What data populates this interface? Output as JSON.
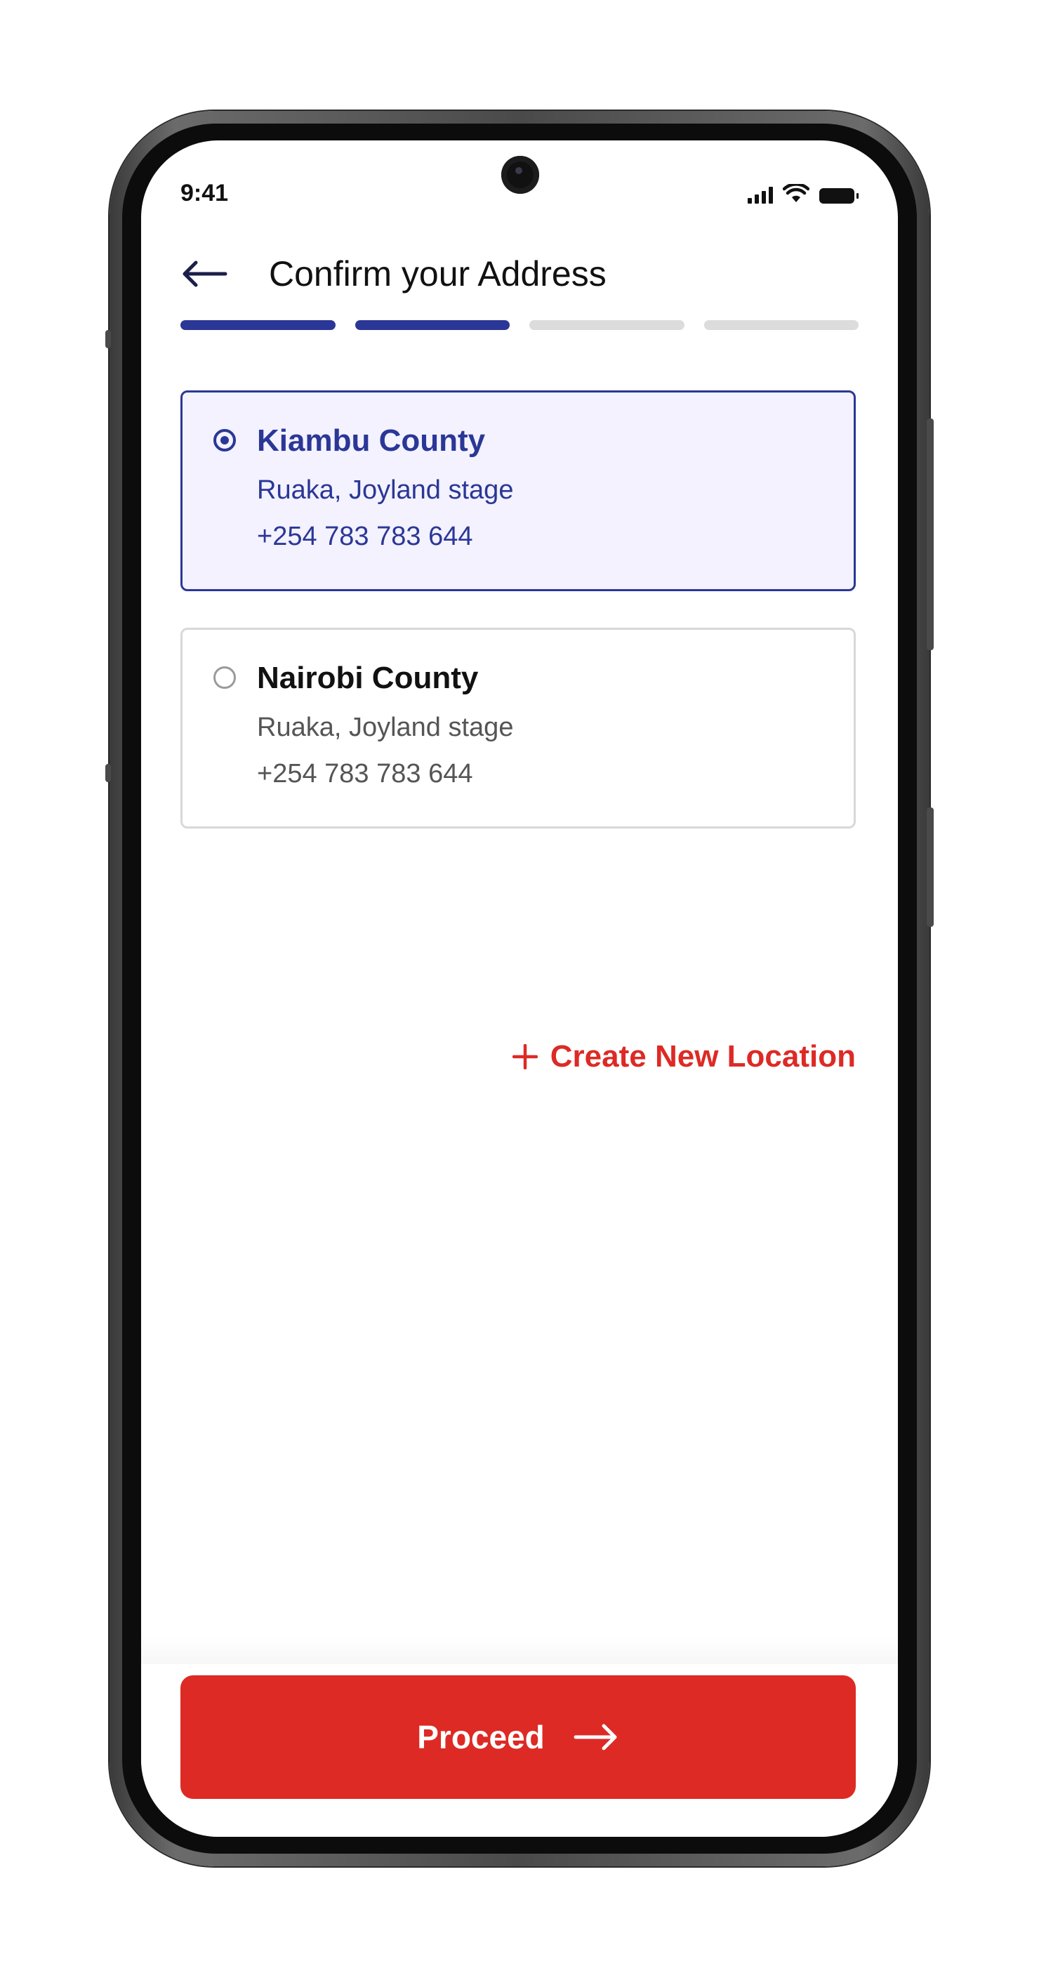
{
  "status_bar": {
    "time": "9:41",
    "icons": [
      "signal-icon",
      "wifi-icon",
      "battery-icon"
    ]
  },
  "header": {
    "back_icon": "arrow-left-icon",
    "title": "Confirm your Address"
  },
  "progress": {
    "total_steps": 4,
    "completed_steps": 2,
    "active_color": "#2b3796",
    "inactive_color": "#dcdcdc"
  },
  "addresses": [
    {
      "name": "Kiambu County",
      "location": "Ruaka, Joyland stage",
      "phone": "+254 783 783 644",
      "selected": true
    },
    {
      "name": "Nairobi County",
      "location": "Ruaka, Joyland stage",
      "phone": "+254 783 783 644",
      "selected": false
    }
  ],
  "create_location": {
    "icon": "plus-icon",
    "label": "Create New Location"
  },
  "proceed_button": {
    "label": "Proceed",
    "icon": "arrow-right-icon"
  },
  "colors": {
    "brand_blue": "#2b3796",
    "brand_red": "#dd2a25",
    "selected_card_bg": "#f3f2fe"
  }
}
